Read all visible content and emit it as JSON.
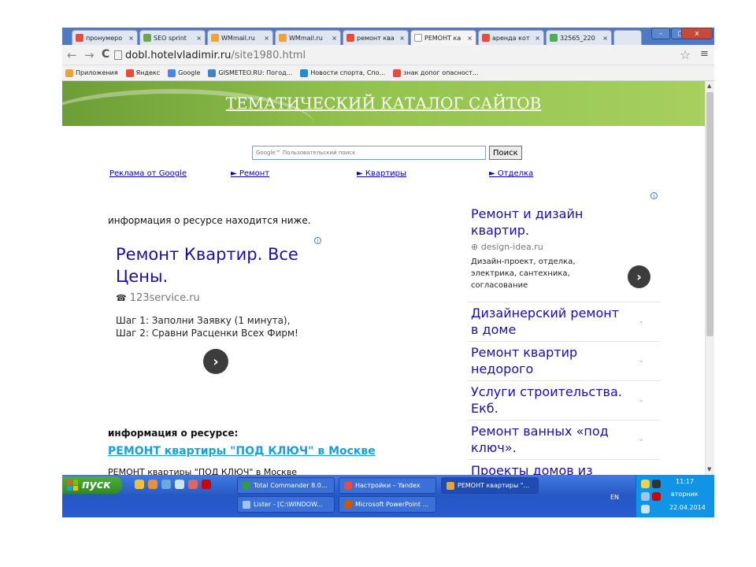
{
  "browser": {
    "tabs": [
      {
        "label": "пронумеро",
        "color": "#e74c3c"
      },
      {
        "label": "SEO sprint",
        "color": "#6aa84f"
      },
      {
        "label": "WMmail.ru",
        "color": "#f1a33b"
      },
      {
        "label": "WMmail.ru",
        "color": "#f1a33b"
      },
      {
        "label": "ремонт ква",
        "color": "#e74c3c"
      },
      {
        "label": "РЕМОНТ ка",
        "color": "#ffffff",
        "active": true
      },
      {
        "label": "аренда кот",
        "color": "#e74c3c"
      },
      {
        "label": "32565_220",
        "color": "#4caf50"
      }
    ],
    "tab_close": "×",
    "window_buttons": {
      "minimize": "–",
      "restore": "◻",
      "close": "x"
    },
    "nav": {
      "back": "←",
      "forward": "→",
      "reload": "C"
    },
    "url_host": "dobl.hotelvladimir.ru",
    "url_path": "/site1980.html",
    "star": "☆",
    "menu": "≡",
    "bookmarks": [
      {
        "label": "Приложения",
        "color": "#e8a33a"
      },
      {
        "label": "Яндекс",
        "color": "#e74c3c"
      },
      {
        "label": "Google",
        "color": "#4a86e8"
      },
      {
        "label": "GISMETEO.RU: Погод...",
        "color": "#3d85c6"
      },
      {
        "label": "Новости спорта, Спо...",
        "color": "#1f8ad8"
      },
      {
        "label": "знак допог опасност...",
        "color": "#e74c3c"
      }
    ]
  },
  "page": {
    "banner_title": "ТЕМАТИЧЕСКИЙ КАТАЛОГ САЙТОВ",
    "search": {
      "placeholder": "Google™ Пользовательский поиск",
      "button": "Поиск"
    },
    "top_links": [
      "Реклама от Google",
      "► Ремонт",
      "► Квартиры",
      "► Отделка"
    ],
    "left_info": "информация о ресурсе находится ниже.",
    "ad_main": {
      "title": "Ремонт Квартир. Все Цены.",
      "url": "123service.ru",
      "line1": "Шаг 1: Заполни Заявку (1 минута),",
      "line2": "Шаг 2: Сравни Расценки Всех Фирм!"
    },
    "info_heading": "информация о ресурсе:",
    "resource_link": "РЕМОНТ квартиры \"ПОД КЛЮЧ\" в Москве",
    "resource_desc": "РЕМОНТ квартиры \"ПОД КЛЮЧ\" в Москве",
    "adchoice": "i",
    "arrow": "›",
    "right_ads": {
      "first": {
        "title": "Ремонт и дизайн квартир.",
        "url": "design-idea.ru",
        "text": "Дизайн-проект, отделка, электрика, сантехника, согласование"
      },
      "items": [
        "Дизайнерский ремонт в доме",
        "Ремонт квартир недорого",
        "Услуги строительства. Екб.",
        "Ремонт ванных «под ключ».",
        "Проекты домов из"
      ],
      "chevron": "⌄"
    }
  },
  "taskbar": {
    "start": "пуск",
    "tasks": [
      {
        "label": "Total Commander 8.0...",
        "color": "#2d9c4a"
      },
      {
        "label": "Настройки – Yandex",
        "color": "#e74c3c"
      },
      {
        "label": "РЕМОНТ квартиры \"...",
        "color": "#e8a33a",
        "active": true
      },
      {
        "label": "Lister - [C:\\WINDOW...",
        "color": "#9fc5e8"
      },
      {
        "label": "Microsoft PowerPoint ...",
        "color": "#d35400"
      }
    ],
    "lang": "EN",
    "time": "11:17",
    "day": "вторник",
    "date": "22.04.2014"
  }
}
